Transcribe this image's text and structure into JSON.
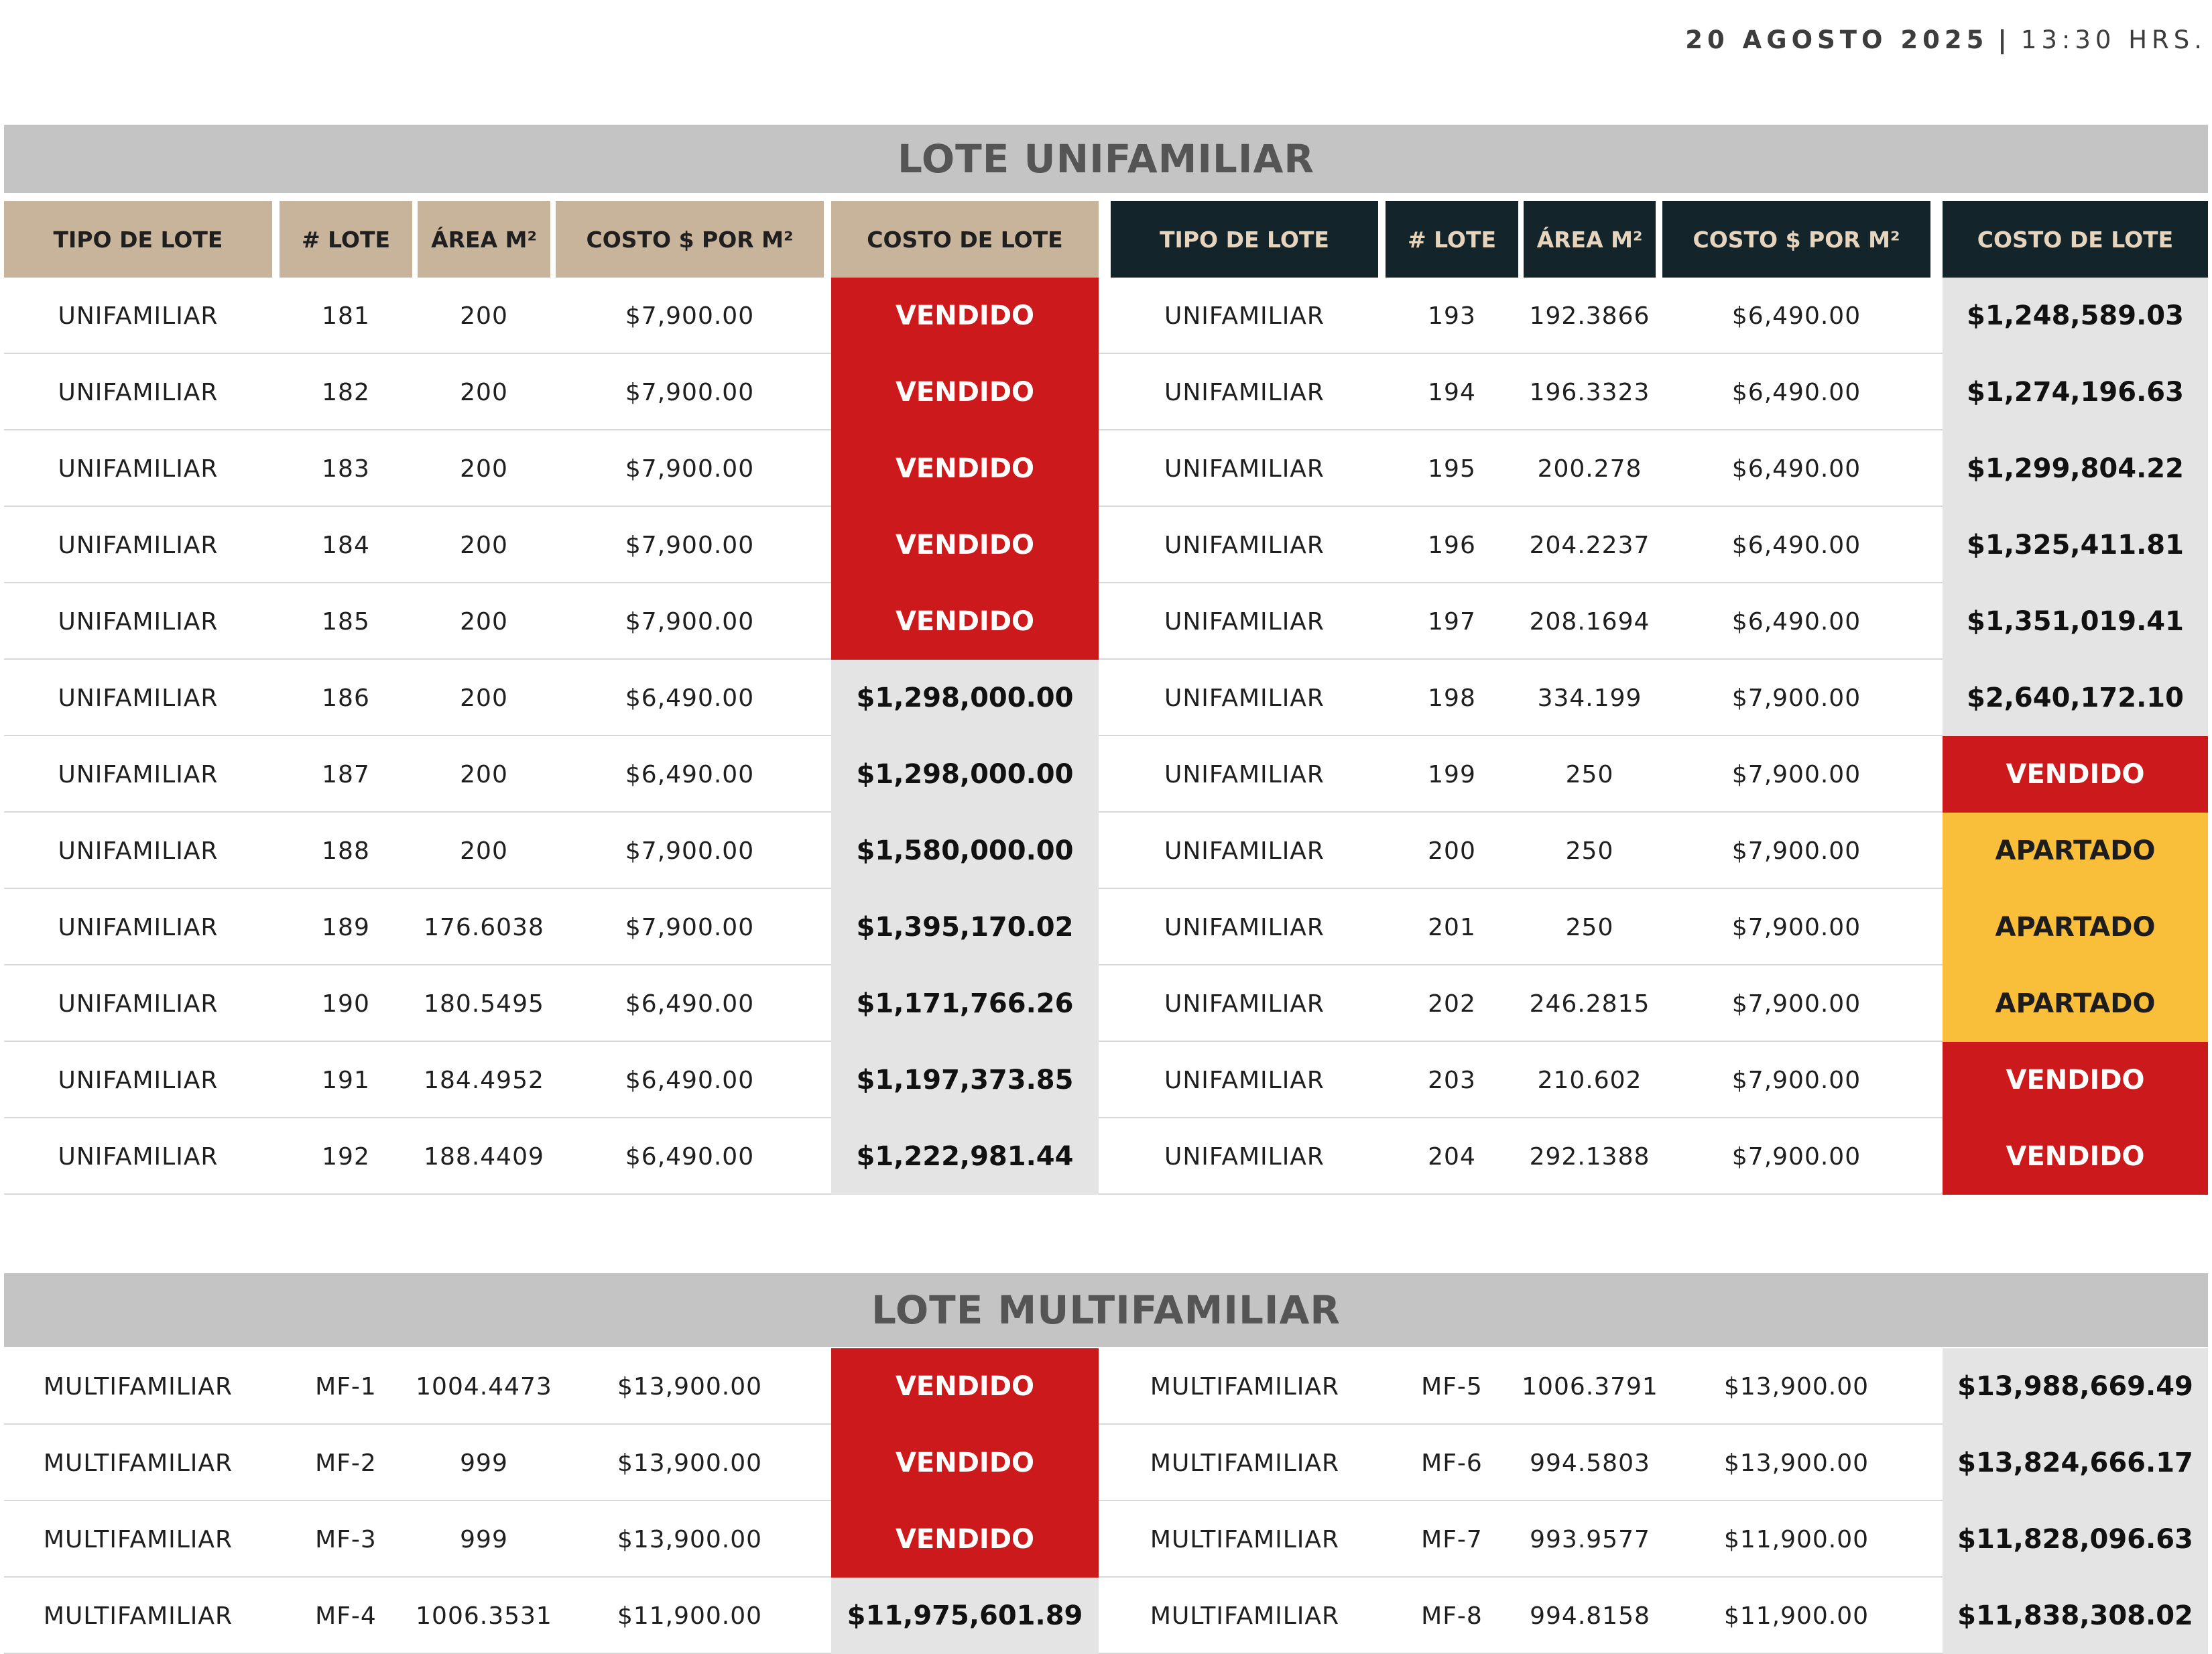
{
  "date": {
    "day": "20 AGOSTO 2025",
    "separator": "|",
    "time": "13:30 HRS."
  },
  "unifamiliar": {
    "title": "LOTE UNIFAMILIAR",
    "headers": [
      "TIPO DE LOTE",
      "# LOTE",
      "ÁREA M²",
      "COSTO $ POR M²",
      "COSTO DE LOTE"
    ],
    "left": [
      {
        "tipo": "UNIFAMILIAR",
        "lote": "181",
        "area": "200",
        "costo_m2": "$7,900.00",
        "costo": "VENDIDO",
        "status": "vendido"
      },
      {
        "tipo": "UNIFAMILIAR",
        "lote": "182",
        "area": "200",
        "costo_m2": "$7,900.00",
        "costo": "VENDIDO",
        "status": "vendido"
      },
      {
        "tipo": "UNIFAMILIAR",
        "lote": "183",
        "area": "200",
        "costo_m2": "$7,900.00",
        "costo": "VENDIDO",
        "status": "vendido"
      },
      {
        "tipo": "UNIFAMILIAR",
        "lote": "184",
        "area": "200",
        "costo_m2": "$7,900.00",
        "costo": "VENDIDO",
        "status": "vendido"
      },
      {
        "tipo": "UNIFAMILIAR",
        "lote": "185",
        "area": "200",
        "costo_m2": "$7,900.00",
        "costo": "VENDIDO",
        "status": "vendido"
      },
      {
        "tipo": "UNIFAMILIAR",
        "lote": "186",
        "area": "200",
        "costo_m2": "$6,490.00",
        "costo": "$1,298,000.00",
        "status": "available"
      },
      {
        "tipo": "UNIFAMILIAR",
        "lote": "187",
        "area": "200",
        "costo_m2": "$6,490.00",
        "costo": "$1,298,000.00",
        "status": "available"
      },
      {
        "tipo": "UNIFAMILIAR",
        "lote": "188",
        "area": "200",
        "costo_m2": "$7,900.00",
        "costo": "$1,580,000.00",
        "status": "available"
      },
      {
        "tipo": "UNIFAMILIAR",
        "lote": "189",
        "area": "176.6038",
        "costo_m2": "$7,900.00",
        "costo": "$1,395,170.02",
        "status": "available"
      },
      {
        "tipo": "UNIFAMILIAR",
        "lote": "190",
        "area": "180.5495",
        "costo_m2": "$6,490.00",
        "costo": "$1,171,766.26",
        "status": "available"
      },
      {
        "tipo": "UNIFAMILIAR",
        "lote": "191",
        "area": "184.4952",
        "costo_m2": "$6,490.00",
        "costo": "$1,197,373.85",
        "status": "available"
      },
      {
        "tipo": "UNIFAMILIAR",
        "lote": "192",
        "area": "188.4409",
        "costo_m2": "$6,490.00",
        "costo": "$1,222,981.44",
        "status": "available"
      }
    ],
    "right": [
      {
        "tipo": "UNIFAMILIAR",
        "lote": "193",
        "area": "192.3866",
        "costo_m2": "$6,490.00",
        "costo": "$1,248,589.03",
        "status": "available"
      },
      {
        "tipo": "UNIFAMILIAR",
        "lote": "194",
        "area": "196.3323",
        "costo_m2": "$6,490.00",
        "costo": "$1,274,196.63",
        "status": "available"
      },
      {
        "tipo": "UNIFAMILIAR",
        "lote": "195",
        "area": "200.278",
        "costo_m2": "$6,490.00",
        "costo": "$1,299,804.22",
        "status": "available"
      },
      {
        "tipo": "UNIFAMILIAR",
        "lote": "196",
        "area": "204.2237",
        "costo_m2": "$6,490.00",
        "costo": "$1,325,411.81",
        "status": "available"
      },
      {
        "tipo": "UNIFAMILIAR",
        "lote": "197",
        "area": "208.1694",
        "costo_m2": "$6,490.00",
        "costo": "$1,351,019.41",
        "status": "available"
      },
      {
        "tipo": "UNIFAMILIAR",
        "lote": "198",
        "area": "334.199",
        "costo_m2": "$7,900.00",
        "costo": "$2,640,172.10",
        "status": "available"
      },
      {
        "tipo": "UNIFAMILIAR",
        "lote": "199",
        "area": "250",
        "costo_m2": "$7,900.00",
        "costo": "VENDIDO",
        "status": "vendido"
      },
      {
        "tipo": "UNIFAMILIAR",
        "lote": "200",
        "area": "250",
        "costo_m2": "$7,900.00",
        "costo": "APARTADO",
        "status": "apartado"
      },
      {
        "tipo": "UNIFAMILIAR",
        "lote": "201",
        "area": "250",
        "costo_m2": "$7,900.00",
        "costo": "APARTADO",
        "status": "apartado"
      },
      {
        "tipo": "UNIFAMILIAR",
        "lote": "202",
        "area": "246.2815",
        "costo_m2": "$7,900.00",
        "costo": "APARTADO",
        "status": "apartado"
      },
      {
        "tipo": "UNIFAMILIAR",
        "lote": "203",
        "area": "210.602",
        "costo_m2": "$7,900.00",
        "costo": "VENDIDO",
        "status": "vendido"
      },
      {
        "tipo": "UNIFAMILIAR",
        "lote": "204",
        "area": "292.1388",
        "costo_m2": "$7,900.00",
        "costo": "VENDIDO",
        "status": "vendido"
      }
    ]
  },
  "multifamiliar": {
    "title": "LOTE MULTIFAMILIAR",
    "left": [
      {
        "tipo": "MULTIFAMILIAR",
        "lote": "MF-1",
        "area": "1004.4473",
        "costo_m2": "$13,900.00",
        "costo": "VENDIDO",
        "status": "vendido"
      },
      {
        "tipo": "MULTIFAMILIAR",
        "lote": "MF-2",
        "area": "999",
        "costo_m2": "$13,900.00",
        "costo": "VENDIDO",
        "status": "vendido"
      },
      {
        "tipo": "MULTIFAMILIAR",
        "lote": "MF-3",
        "area": "999",
        "costo_m2": "$13,900.00",
        "costo": "VENDIDO",
        "status": "vendido"
      },
      {
        "tipo": "MULTIFAMILIAR",
        "lote": "MF-4",
        "area": "1006.3531",
        "costo_m2": "$11,900.00",
        "costo": "$11,975,601.89",
        "status": "available"
      }
    ],
    "right": [
      {
        "tipo": "MULTIFAMILIAR",
        "lote": "MF-5",
        "area": "1006.3791",
        "costo_m2": "$13,900.00",
        "costo": "$13,988,669.49",
        "status": "available"
      },
      {
        "tipo": "MULTIFAMILIAR",
        "lote": "MF-6",
        "area": "994.5803",
        "costo_m2": "$13,900.00",
        "costo": "$13,824,666.17",
        "status": "available"
      },
      {
        "tipo": "MULTIFAMILIAR",
        "lote": "MF-7",
        "area": "993.9577",
        "costo_m2": "$11,900.00",
        "costo": "$11,828,096.63",
        "status": "available"
      },
      {
        "tipo": "MULTIFAMILIAR",
        "lote": "MF-8",
        "area": "994.8158",
        "costo_m2": "$11,900.00",
        "costo": "$11,838,308.02",
        "status": "available"
      }
    ]
  }
}
